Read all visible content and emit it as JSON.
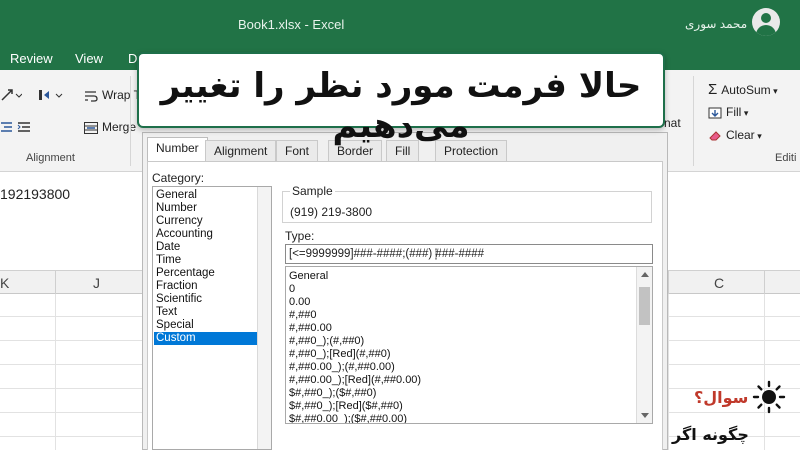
{
  "window": {
    "doc_title": "Book1.xlsx  -  Excel",
    "user_name": "محمد سوری"
  },
  "ribbon_tabs": [
    "Review",
    "View",
    "D"
  ],
  "ribbon": {
    "wrap_text": "Wrap T",
    "merge": "Merge",
    "autosum": "AutoSum",
    "fill": "Fill",
    "clear": "Clear",
    "alignment_group": "Alignment",
    "editing_group": "Editi",
    "format_partial": "nat"
  },
  "sheet": {
    "formula_value": "192193800",
    "columns": [
      "K",
      "J",
      "C"
    ]
  },
  "caption": "حالا فرمت مورد نظر را تغییر می‌دهیم",
  "dialog": {
    "tabs": [
      "Number",
      "Alignment",
      "Font",
      "Border",
      "Fill",
      "Protection"
    ],
    "category_label": "Category:",
    "categories": [
      "General",
      "Number",
      "Currency",
      "Accounting",
      "Date",
      "Time",
      "Percentage",
      "Fraction",
      "Scientific",
      "Text",
      "Special",
      "Custom"
    ],
    "selected_category": "Custom",
    "sample_label": "Sample",
    "sample_value": "(919) 219-3800",
    "type_label": "Type:",
    "type_value": "[<=9999999]###-####;(###) ###-####",
    "formats": [
      "General",
      "0",
      "0.00",
      "#,##0",
      "#,##0.00",
      "#,##0_);(#,##0)",
      "#,##0_);[Red](#,##0)",
      "#,##0.00_);(#,##0.00)",
      "#,##0.00_);[Red](#,##0.00)",
      "$#,##0_);($#,##0)",
      "$#,##0_);[Red]($#,##0)",
      "$#,##0.00_);($#,##0.00)"
    ]
  },
  "question": {
    "label": "سوال؟",
    "line2": "چگونه اگر"
  },
  "colors": {
    "excel_green": "#217346",
    "selection_blue": "#0078d7",
    "question_red": "#c0392b"
  }
}
